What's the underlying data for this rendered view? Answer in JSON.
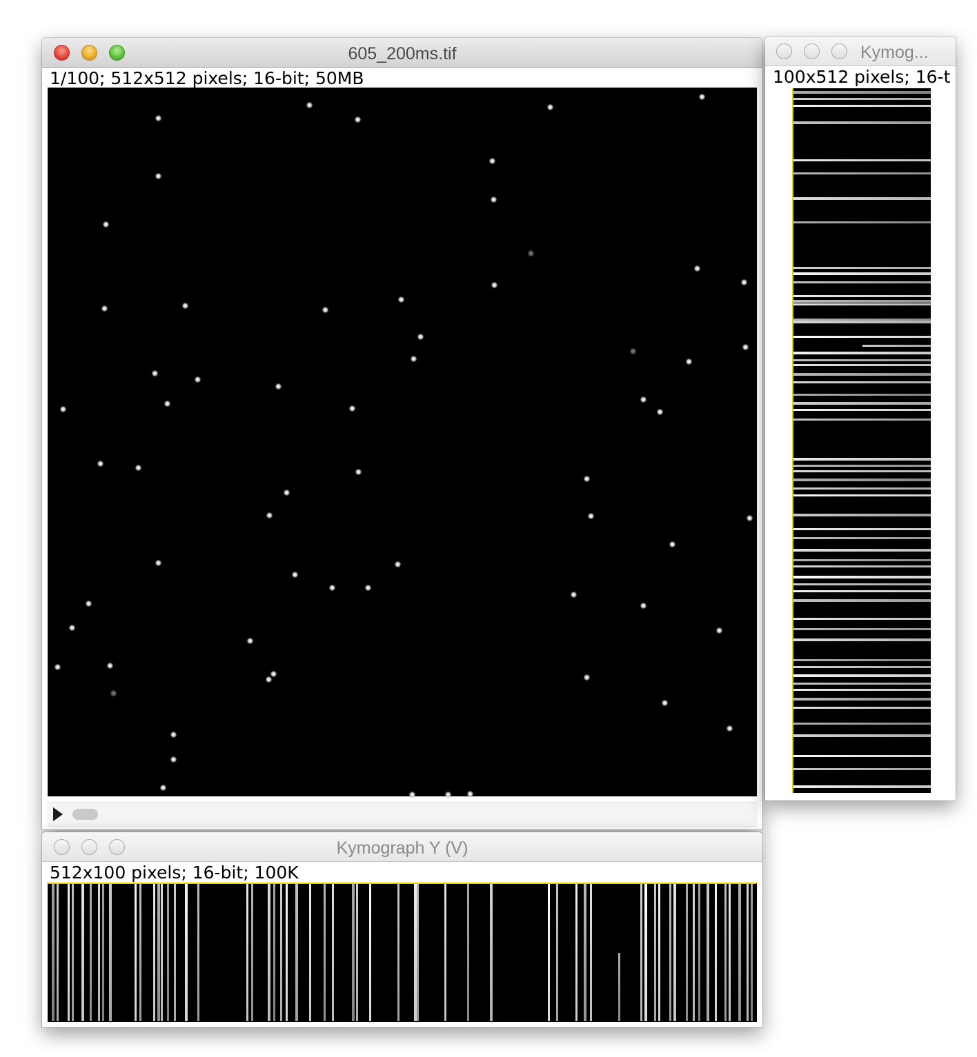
{
  "main_window": {
    "title": "605_200ms.tif",
    "info": "1/100; 512x512 pixels; 16-bit; 50MB",
    "slice_slider": {
      "current_slice": 1,
      "total_slices": 100
    }
  },
  "kymo_x_window": {
    "title": "Kymog...",
    "info": "100x512 pixels; 16-t"
  },
  "kymo_y_window": {
    "title": "Kymograph Y (V)",
    "info": "512x100 pixels; 16-bit; 100K"
  },
  "icons": {
    "close": "close-icon",
    "minimize": "minimize-icon",
    "zoom": "zoom-icon",
    "play": "play-icon"
  },
  "colors": {
    "close": "#e0443a",
    "minimize": "#e9a92a",
    "zoom": "#5cbc3e",
    "roi_line": "#e8d000",
    "image_background": "#000000"
  }
}
